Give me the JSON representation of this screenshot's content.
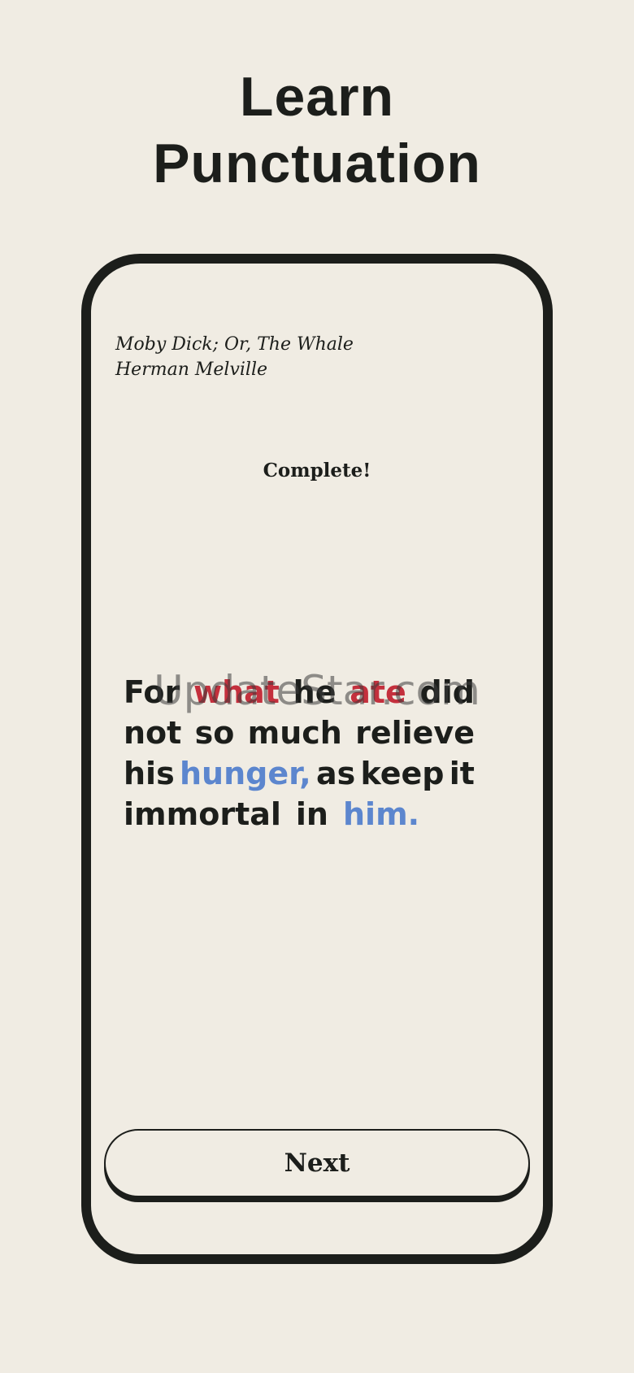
{
  "header": {
    "title_line1": "Learn",
    "title_line2": "Punctuation"
  },
  "book": {
    "title": "Moby Dick; Or, The Whale",
    "author": "Herman Melville"
  },
  "status": "Complete!",
  "quote": {
    "lines": [
      [
        {
          "text": "For",
          "state": "normal"
        },
        {
          "text": "what",
          "state": "error"
        },
        {
          "text": "he",
          "state": "normal"
        },
        {
          "text": "ate",
          "state": "error"
        },
        {
          "text": "did",
          "state": "normal"
        }
      ],
      [
        {
          "text": "not",
          "state": "normal"
        },
        {
          "text": "so",
          "state": "normal"
        },
        {
          "text": "much",
          "state": "normal"
        },
        {
          "text": "relieve",
          "state": "normal"
        }
      ],
      [
        {
          "text": "his",
          "state": "normal"
        },
        {
          "text": "hunger,",
          "state": "correct"
        },
        {
          "text": "as",
          "state": "normal"
        },
        {
          "text": "keep",
          "state": "normal"
        },
        {
          "text": "it",
          "state": "normal"
        }
      ],
      [
        {
          "text": "immortal",
          "state": "normal"
        },
        {
          "text": "in",
          "state": "normal"
        },
        {
          "text": "him.",
          "state": "correct"
        }
      ]
    ]
  },
  "watermark": "UpdateStar.com",
  "actions": {
    "next_label": "Next"
  },
  "colors": {
    "background": "#f0ece3",
    "ink": "#1c1e1b",
    "error": "#c4303d",
    "correct": "#5c86ce"
  }
}
